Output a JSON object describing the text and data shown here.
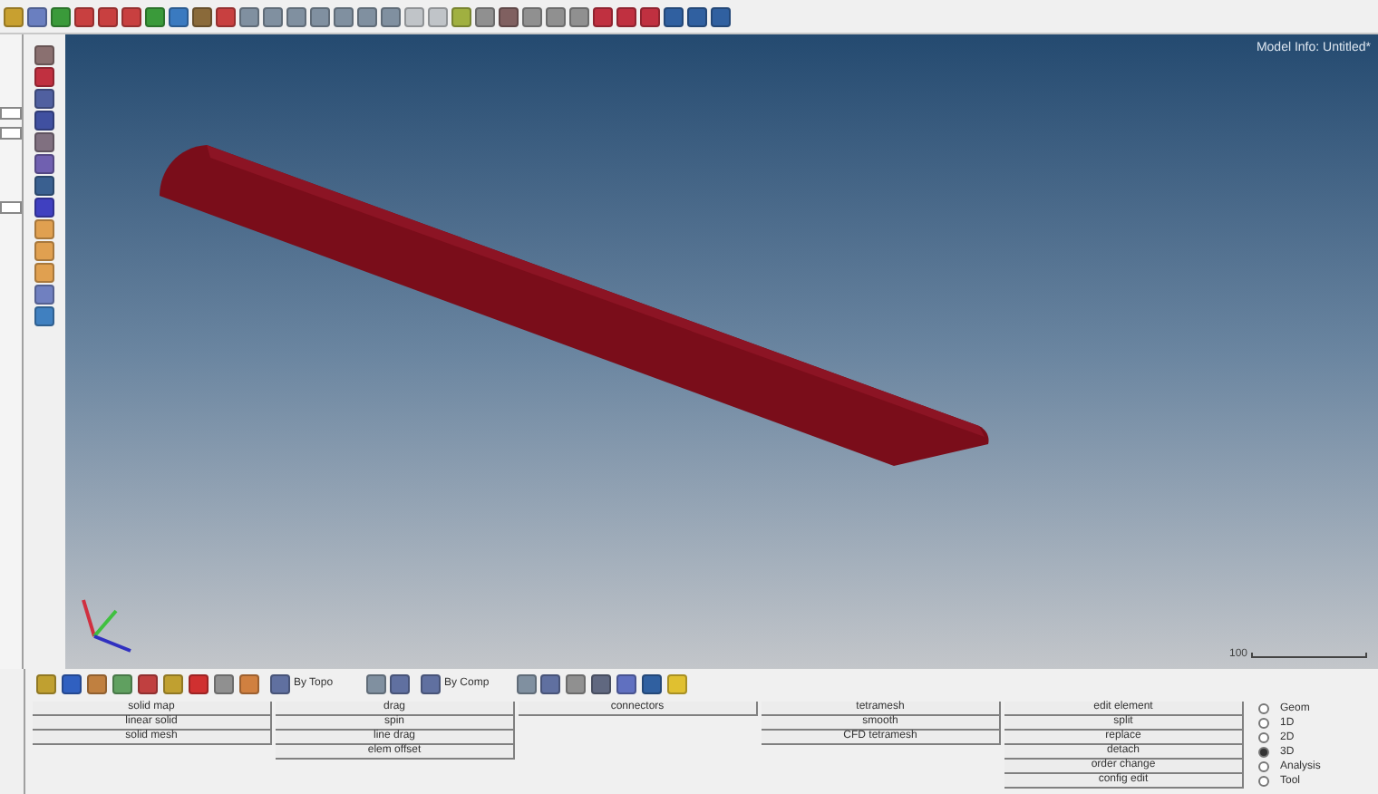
{
  "viewport": {
    "model_info": "Model Info: Untitled*",
    "scale_label": "100"
  },
  "toolbar": {
    "combos": [
      {
        "label": "By Topo"
      },
      {
        "label": "By Comp"
      }
    ]
  },
  "panel": {
    "columns": [
      {
        "buttons": [
          "solid map",
          "linear solid",
          "solid mesh"
        ]
      },
      {
        "buttons": [
          "drag",
          "spin",
          "line drag",
          "elem offset"
        ]
      },
      {
        "buttons": [
          "connectors"
        ]
      },
      {
        "buttons": [
          "tetramesh",
          "smooth",
          "CFD tetramesh"
        ]
      },
      {
        "buttons": [
          "edit element",
          "split",
          "replace",
          "detach",
          "order change",
          "config edit"
        ]
      }
    ],
    "pages": [
      {
        "label": "Geom",
        "selected": false
      },
      {
        "label": "1D",
        "selected": false
      },
      {
        "label": "2D",
        "selected": false
      },
      {
        "label": "3D",
        "selected": true
      },
      {
        "label": "Analysis",
        "selected": false
      },
      {
        "label": "Tool",
        "selected": false
      }
    ]
  }
}
